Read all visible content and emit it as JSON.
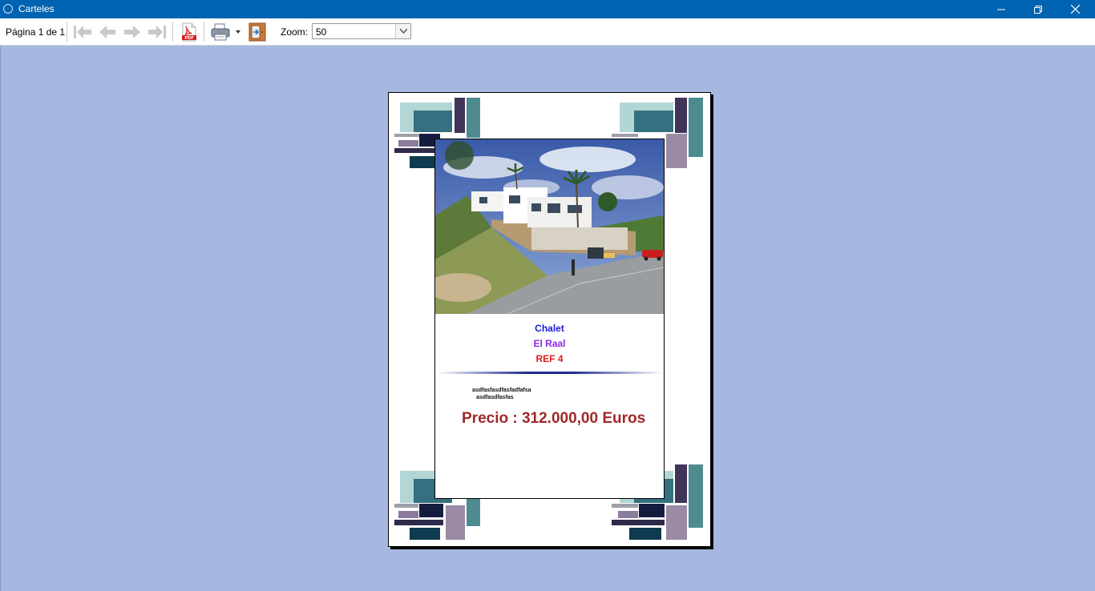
{
  "window": {
    "title": "Carteles",
    "colors": {
      "titlebar": "#0063b1",
      "viewer_bg": "#a7b8e0"
    }
  },
  "toolbar": {
    "page_info": "Página 1 de 1",
    "buttons": [
      {
        "name": "first-page",
        "icon": "first-page-icon",
        "enabled": false
      },
      {
        "name": "previous-page",
        "icon": "arrow-left-icon",
        "enabled": false
      },
      {
        "name": "next-page",
        "icon": "arrow-right-icon",
        "enabled": false
      },
      {
        "name": "last-page",
        "icon": "last-page-icon",
        "enabled": false
      },
      {
        "name": "export-pdf",
        "icon": "pdf-icon",
        "enabled": true
      },
      {
        "name": "print",
        "icon": "printer-icon",
        "enabled": true
      },
      {
        "name": "exit",
        "icon": "exit-door-icon",
        "enabled": true
      }
    ],
    "zoom_label": "Zoom:",
    "zoom_value": "50"
  },
  "poster": {
    "type_line": "Chalet",
    "location_line": "El Raal",
    "ref_line": "REF 4",
    "description_line1": "asdfasfasdfasfadfafsa",
    "description_line2": "asdfasdfasfas",
    "price": "Precio : 312.000,00 Euros",
    "colors": {
      "type": "#1a1ad6",
      "location": "#8a2be2",
      "ref": "#e01b1b",
      "price": "#a02828"
    }
  }
}
